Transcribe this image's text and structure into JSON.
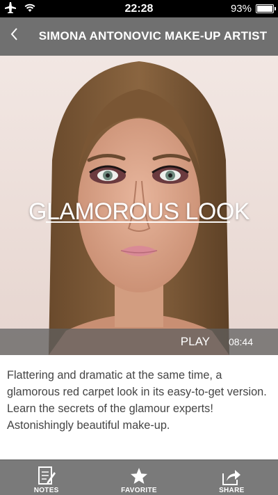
{
  "status_bar": {
    "time": "22:28",
    "battery_percent": "93%",
    "battery_level": 0.93,
    "icons": [
      "airplane-icon",
      "wifi-icon",
      "battery-icon"
    ]
  },
  "nav": {
    "back_icon": "chevron-left-icon",
    "title": "SIMONA ANTONOVIC MAKE-UP ARTIST"
  },
  "video": {
    "title": "GLAMOROUS LOOK",
    "play_label": "PLAY",
    "duration": "08:44"
  },
  "description": "Flattering and dramatic at the same time, a glamorous red carpet look in its easy-to-get version. Learn the secrets of the glamour experts! Astonishingly beautiful make-up.",
  "tabs": [
    {
      "label": "NOTES",
      "icon": "notes-icon"
    },
    {
      "label": "FAVORITE",
      "icon": "star-icon"
    },
    {
      "label": "SHARE",
      "icon": "share-icon"
    }
  ],
  "colors": {
    "nav_bar": "#707070",
    "tab_bar": "#7a7a7a",
    "status_bar": "#000000",
    "description_text": "#444444"
  }
}
